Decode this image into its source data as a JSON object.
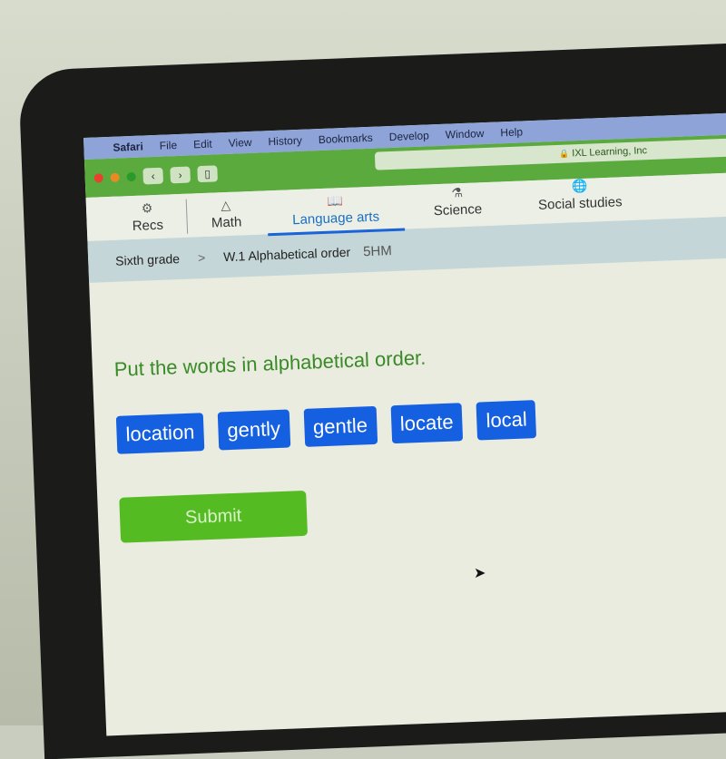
{
  "menubar": {
    "apple": "",
    "items": [
      "Safari",
      "File",
      "Edit",
      "View",
      "History",
      "Bookmarks",
      "Develop",
      "Window",
      "Help"
    ]
  },
  "toolbar": {
    "back": "‹",
    "forward": "›",
    "sidebar": "▯",
    "url_text": "IXL Learning, Inc",
    "lock": "🔒"
  },
  "tabs": [
    {
      "label": "Recs",
      "icon": "⚙"
    },
    {
      "label": "Math",
      "icon": "△"
    },
    {
      "label": "Language arts",
      "icon": "📖"
    },
    {
      "label": "Science",
      "icon": "⚗"
    },
    {
      "label": "Social studies",
      "icon": "🌐"
    }
  ],
  "breadcrumb": {
    "grade": "Sixth grade",
    "sep": ">",
    "skill": "W.1 Alphabetical order",
    "code": "5HM"
  },
  "question": {
    "prompt": "Put the words in alphabetical order.",
    "words": [
      "location",
      "gently",
      "gentle",
      "locate",
      "local"
    ],
    "submit": "Submit"
  }
}
